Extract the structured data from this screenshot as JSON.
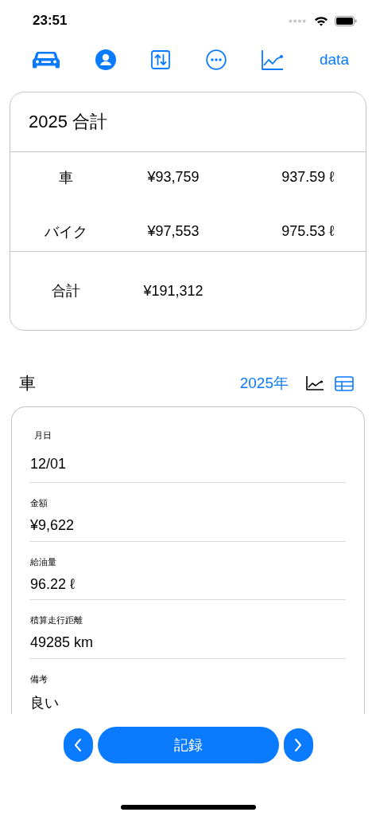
{
  "status_bar": {
    "time": "23:51"
  },
  "toolbar": {
    "icons": [
      {
        "kind": "car"
      },
      {
        "kind": "person"
      },
      {
        "kind": "swap"
      },
      {
        "kind": "more"
      },
      {
        "kind": "chart"
      }
    ],
    "data_button": "data"
  },
  "summary": {
    "title": "2025 合計",
    "rows": [
      {
        "name": "車",
        "amount": "¥93,759",
        "volume": "937.59 ℓ"
      },
      {
        "name": "バイク",
        "amount": "¥97,553",
        "volume": "975.53 ℓ"
      }
    ],
    "total": {
      "name": "合計",
      "amount": "¥191,312"
    }
  },
  "section": {
    "title": "車",
    "year": "2025年",
    "views": [
      {
        "kind": "chart",
        "selected": false
      },
      {
        "kind": "table",
        "selected": true
      }
    ]
  },
  "record": {
    "fields": [
      {
        "label": "月日",
        "value": "12/01"
      },
      {
        "label": "金額",
        "value": "¥9,622"
      },
      {
        "label": "給油量",
        "value": "96.22 ℓ"
      },
      {
        "label": "積算走行距離",
        "value": "49285 km"
      },
      {
        "label": "備考",
        "value": "良い"
      }
    ]
  },
  "bottom": {
    "record_button": "記録"
  }
}
